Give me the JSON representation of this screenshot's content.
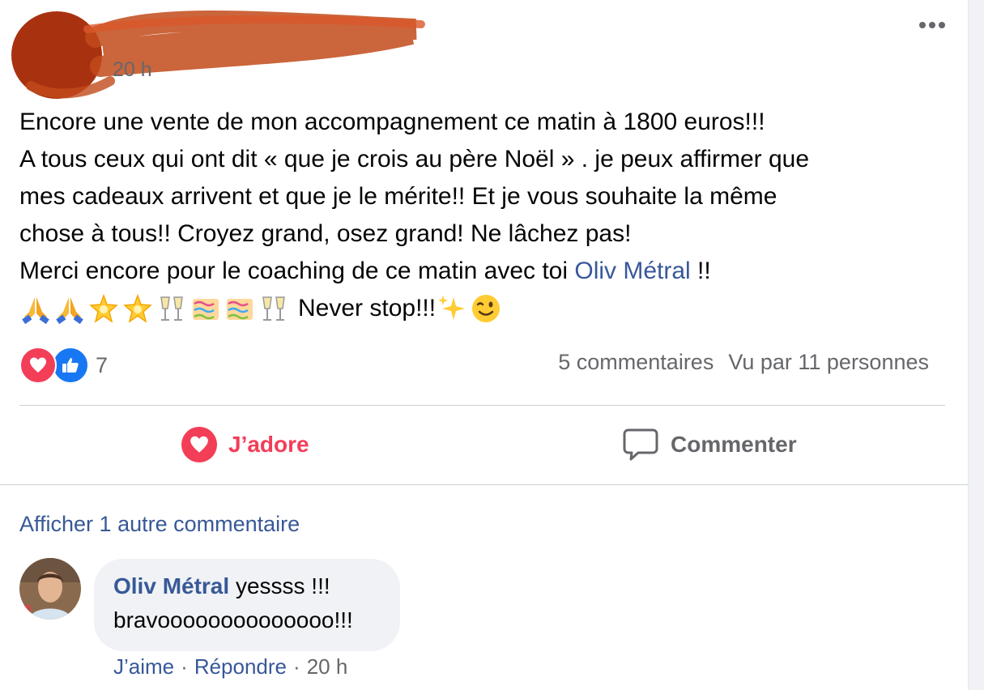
{
  "post": {
    "timestamp": "20 h",
    "text": {
      "line1": "Encore une vente de mon accompagnement ce matin à 1800 euros!!!",
      "line2": "A tous ceux qui ont dit « que je crois au père Noël » . je peux affirmer que",
      "line3": "mes cadeaux arrivent et que je le mérite!! Et je vous souhaite la même",
      "line4": "chose à tous!! Croyez grand, osez grand! Ne lâchez pas!",
      "line5_before": "Merci encore pour le coaching de ce matin avec toi ",
      "line5_mention": "Oliv Métral",
      "line5_after": " !!",
      "line6_emojis": [
        "folded-hands",
        "folded-hands",
        "glowing-star",
        "glowing-star",
        "clinking-glasses",
        "party-popper",
        "party-popper",
        "clinking-glasses"
      ],
      "line6_text": "Never stop!!!",
      "line6_trailing_emojis": [
        "sparkles",
        "winking-face"
      ]
    },
    "reactions": {
      "types": [
        "love",
        "like"
      ],
      "count": "7"
    },
    "stats": {
      "comments": "5 commentaires",
      "views": "Vu par 11 personnes"
    },
    "actions": {
      "adore_label": "J’adore",
      "comment_label": "Commenter"
    },
    "colors": {
      "love": "#f33e58",
      "like": "#1877f2",
      "link": "#385898",
      "muted": "#65676b",
      "redaction": "#b03a10"
    }
  },
  "comments": {
    "more_label": "Afficher 1 autre commentaire",
    "items": [
      {
        "author": "Oliv Métral",
        "text_line1": " yessss !!!",
        "text_line2": "bravoooooooooooooo!!!",
        "like_label": "J’aime",
        "separator": "·",
        "reply_label": "Répondre",
        "time": "20 h"
      }
    ]
  }
}
